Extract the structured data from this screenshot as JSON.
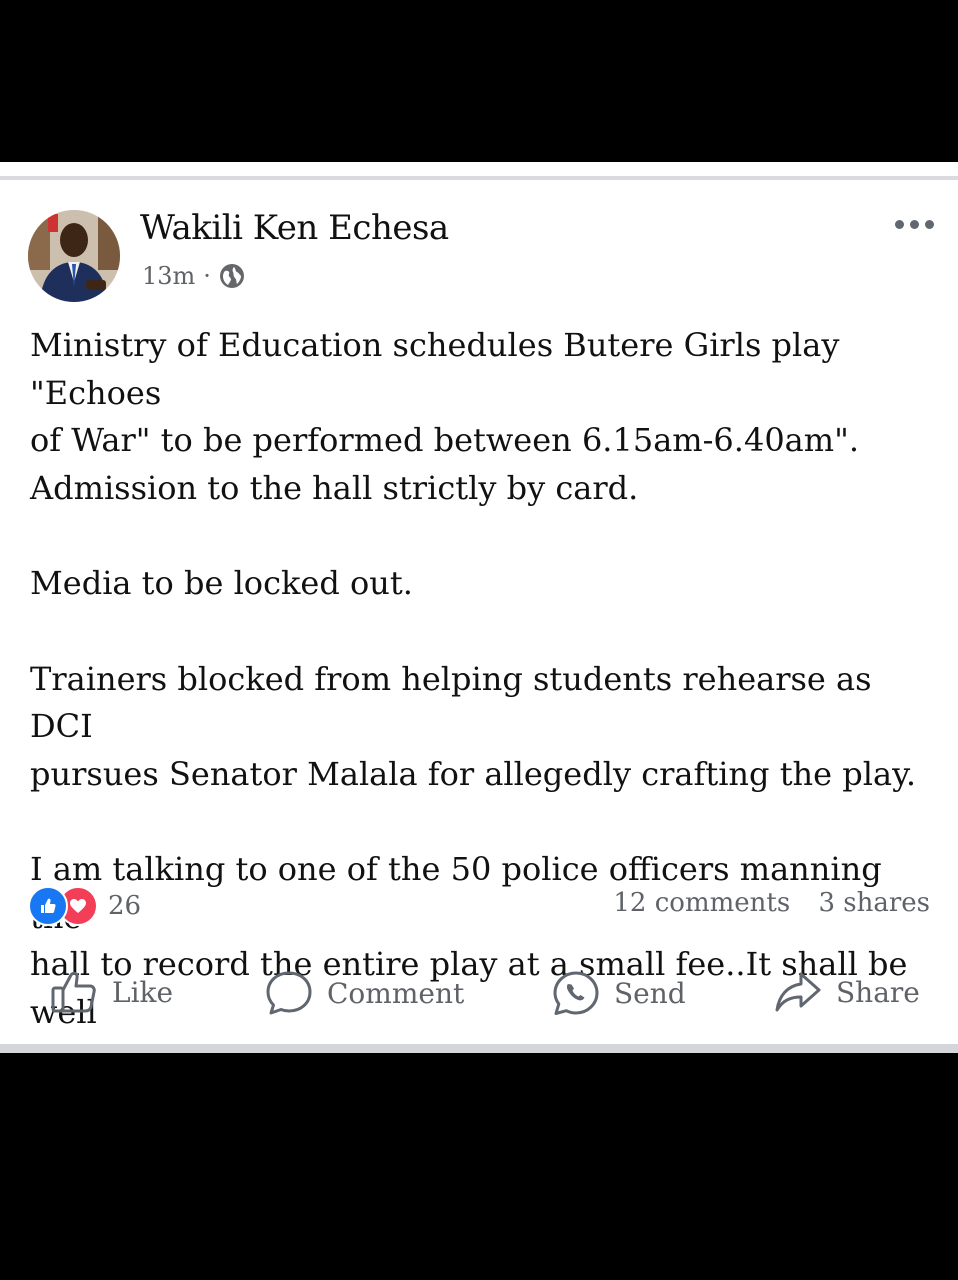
{
  "post": {
    "author": "Wakili Ken Echesa",
    "time": "13m",
    "dot": "·",
    "paragraphs": [
      "Ministry of Education schedules Butere Girls play \"Echoes\nof War\" to be performed between 6.15am-6.40am\".\nAdmission to the hall strictly by card.",
      "Media to be  locked out.",
      "Trainers blocked from helping students rehearse as DCI\npursues Senator Malala for allegedly crafting the play.",
      "I am talking to one of the 50 police officers manning the\nhall to record the entire play at a small fee..It shall be well"
    ]
  },
  "reactions": {
    "count": "26",
    "comments": "12 comments",
    "shares": "3 shares"
  },
  "actions": {
    "like": "Like",
    "comment": "Comment",
    "send": "Send",
    "share": "Share"
  },
  "icons": {
    "globe": "globe-icon",
    "more": "more-icon",
    "like": "thumbs-up-icon",
    "love": "heart-icon",
    "comment": "comment-bubble-icon",
    "send": "whatsapp-icon",
    "share": "share-arrow-icon"
  },
  "colors": {
    "like_blue": "#1877f2",
    "love_red": "#f33e58",
    "text": "#111111",
    "muted": "#5f6368",
    "background": "#000000",
    "card": "#ffffff"
  }
}
